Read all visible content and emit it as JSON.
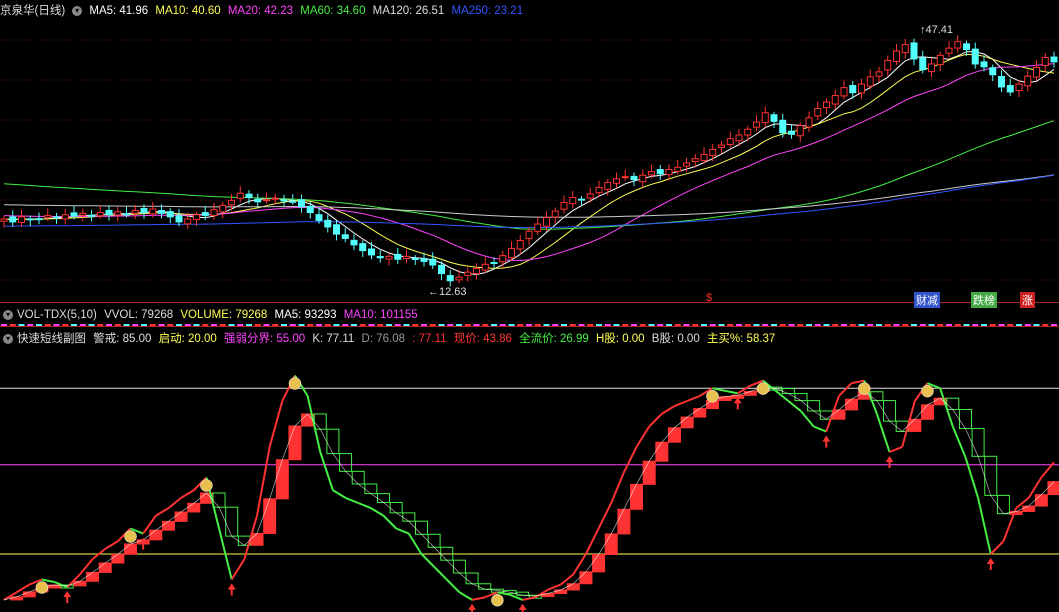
{
  "main_header": {
    "title": "京泉华(日线)",
    "ma5": "MA5: 41.96",
    "ma10": "MA10: 40.60",
    "ma20": "MA20: 42.23",
    "ma60": "MA60: 34.60",
    "ma120": "MA120: 26.51",
    "ma250": "MA250: 23.21"
  },
  "vol_header": {
    "name": "VOL-TDX(5,10)",
    "vvol": "VVOL: 79268",
    "volume": "VOLUME: 79268",
    "ma5": "MA5: 93293",
    "ma10": "MA10: 101155"
  },
  "ind_header": {
    "name": "快速短线副图",
    "alert": "警戒: 85.00",
    "start": "启动: 20.00",
    "boundary": "强弱分界: 55.00",
    "k": "K: 77.11",
    "d": "D: 76.08",
    "j": ": 77.11",
    "price": "现价: 43.86",
    "float_price": "全流价: 26.99",
    "h_share": "H股: 0.00",
    "b_share": "B股: 0.00",
    "main_buy": "主买%: 58.37"
  },
  "markers": {
    "high": "47.41",
    "low": "12.63",
    "s_tag": "$",
    "tag1": "财减",
    "tag2": "跌榜",
    "tag3": "涨"
  },
  "colors": {
    "up": "#ff3333",
    "down": "#54ffff",
    "ma5": "#ffffff",
    "ma10": "#ffff55",
    "ma20": "#ff44ff",
    "ma60": "#44ee44",
    "ma120": "#cccccc",
    "ma250": "#3355ff"
  },
  "chart_data": [
    {
      "type": "candlestick",
      "title": "京泉华(日线)",
      "ylim": [
        11,
        50
      ],
      "annotations": [
        {
          "label": "47.41",
          "kind": "high"
        },
        {
          "label": "12.63",
          "kind": "low"
        }
      ],
      "close": [
        22.0,
        21.6,
        22.3,
        21.9,
        22.0,
        22.5,
        22.2,
        22.6,
        22.4,
        22.8,
        22.5,
        22.9,
        22.6,
        23.0,
        22.7,
        23.2,
        22.9,
        23.4,
        22.8,
        22.3,
        21.6,
        22.0,
        22.6,
        22.5,
        23.3,
        23.9,
        24.6,
        25.6,
        25.0,
        24.4,
        24.7,
        24.9,
        24.6,
        24.4,
        23.7,
        22.9,
        21.8,
        20.9,
        19.9,
        19.3,
        18.4,
        17.6,
        17.0,
        16.6,
        16.8,
        16.4,
        16.8,
        16.5,
        16.1,
        15.6,
        14.4,
        13.4,
        13.9,
        14.6,
        15.1,
        15.7,
        15.9,
        16.9,
        17.9,
        19.0,
        20.3,
        21.3,
        22.2,
        23.1,
        24.3,
        25.0,
        24.7,
        25.5,
        26.4,
        27.1,
        27.6,
        27.9,
        27.5,
        28.1,
        28.6,
        28.3,
        28.9,
        29.2,
        29.8,
        30.4,
        31.0,
        31.7,
        32.3,
        33.2,
        33.7,
        34.5,
        35.5,
        36.8,
        35.6,
        34.0,
        33.8,
        35.0,
        36.1,
        37.4,
        38.3,
        39.2,
        40.3,
        39.6,
        40.8,
        41.8,
        42.5,
        44.1,
        45.4,
        46.3,
        44.3,
        42.8,
        43.6,
        44.8,
        45.8,
        46.7,
        45.6,
        43.6,
        43.2,
        42.1,
        40.4,
        39.7,
        40.8,
        41.9,
        43.1,
        44.5,
        43.9
      ]
    },
    {
      "type": "line",
      "title": "快速短线副图",
      "ylim": [
        0,
        100
      ],
      "reference_lines": [
        85,
        55,
        20
      ],
      "series": [
        {
          "name": "K",
          "values": [
            2,
            5,
            8,
            10,
            9,
            7,
            12,
            18,
            22,
            25,
            30,
            28,
            35,
            38,
            42,
            45,
            50,
            30,
            10,
            18,
            35,
            62,
            80,
            90,
            82,
            60,
            45,
            42,
            40,
            38,
            35,
            30,
            28,
            20,
            15,
            10,
            5,
            2,
            3,
            5,
            4,
            2,
            3,
            6,
            8,
            12,
            20,
            30,
            40,
            52,
            62,
            70,
            75,
            78,
            80,
            82,
            85,
            84,
            83,
            86,
            88,
            84,
            80,
            76,
            70,
            68,
            82,
            87,
            88,
            75,
            60,
            62,
            80,
            87,
            85,
            70,
            58,
            42,
            20,
            25,
            38,
            42,
            50,
            56
          ]
        }
      ]
    }
  ]
}
